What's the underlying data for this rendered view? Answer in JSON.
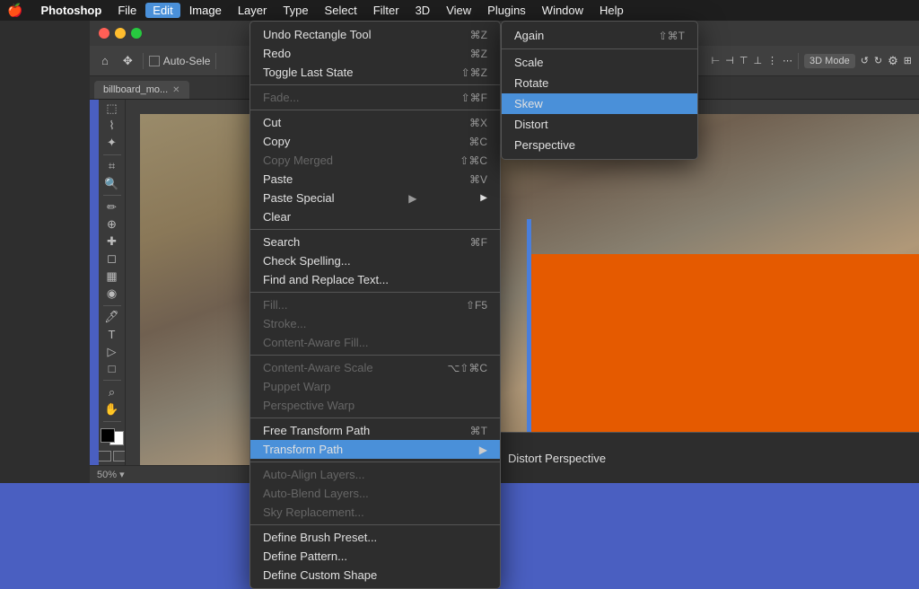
{
  "menubar": {
    "apple": "🍎",
    "items": [
      {
        "label": "Photoshop",
        "active": false,
        "weight": "bold"
      },
      {
        "label": "File",
        "active": false
      },
      {
        "label": "Edit",
        "active": true
      },
      {
        "label": "Image",
        "active": false
      },
      {
        "label": "Layer",
        "active": false
      },
      {
        "label": "Type",
        "active": false
      },
      {
        "label": "Select",
        "active": false
      },
      {
        "label": "Filter",
        "active": false
      },
      {
        "label": "3D",
        "active": false
      },
      {
        "label": "View",
        "active": false
      },
      {
        "label": "Plugins",
        "active": false
      },
      {
        "label": "Window",
        "active": false
      },
      {
        "label": "Help",
        "active": false
      }
    ]
  },
  "titlebar": {
    "traffic_lights": [
      "red",
      "yellow",
      "green"
    ]
  },
  "tabs": [
    {
      "label": "billboard_mo...",
      "active": true
    }
  ],
  "toolbar": {
    "auto_select_label": "Auto-Sele",
    "mode_label": "3D Mode",
    "checkbox": true
  },
  "edit_menu": {
    "items": [
      {
        "label": "Undo Rectangle Tool",
        "shortcut": "⌘Z",
        "disabled": false
      },
      {
        "label": "Redo",
        "shortcut": "⌘Z",
        "disabled": false
      },
      {
        "label": "Toggle Last State",
        "shortcut": "⇧⌘Z",
        "disabled": false
      },
      {
        "type": "divider"
      },
      {
        "label": "Fade...",
        "shortcut": "⇧⌘F",
        "disabled": true
      },
      {
        "type": "divider"
      },
      {
        "label": "Cut",
        "shortcut": "⌘X",
        "disabled": false
      },
      {
        "label": "Copy",
        "shortcut": "⌘C",
        "disabled": false
      },
      {
        "label": "Copy Merged",
        "shortcut": "⇧⌘C",
        "disabled": true
      },
      {
        "label": "Paste",
        "shortcut": "⌘V",
        "disabled": false
      },
      {
        "label": "Paste Special",
        "shortcut": "",
        "has_sub": true,
        "disabled": false
      },
      {
        "label": "Clear",
        "shortcut": "",
        "disabled": false
      },
      {
        "type": "divider"
      },
      {
        "label": "Search",
        "shortcut": "⌘F",
        "disabled": false
      },
      {
        "label": "Check Spelling...",
        "shortcut": "",
        "disabled": false
      },
      {
        "label": "Find and Replace Text...",
        "shortcut": "",
        "disabled": false
      },
      {
        "type": "divider"
      },
      {
        "label": "Fill...",
        "shortcut": "⇧F5",
        "disabled": true
      },
      {
        "label": "Stroke...",
        "shortcut": "",
        "disabled": true
      },
      {
        "label": "Content-Aware Fill...",
        "shortcut": "",
        "disabled": true
      },
      {
        "type": "divider"
      },
      {
        "label": "Content-Aware Scale",
        "shortcut": "⌥⇧⌘C",
        "disabled": true
      },
      {
        "label": "Puppet Warp",
        "shortcut": "",
        "disabled": true
      },
      {
        "label": "Perspective Warp",
        "shortcut": "",
        "disabled": true
      },
      {
        "type": "divider"
      },
      {
        "label": "Free Transform Path",
        "shortcut": "⌘T",
        "disabled": false
      },
      {
        "label": "Transform Path",
        "shortcut": "",
        "has_sub": true,
        "active": true,
        "disabled": false
      },
      {
        "type": "divider"
      },
      {
        "label": "Auto-Align Layers...",
        "shortcut": "",
        "disabled": true
      },
      {
        "label": "Auto-Blend Layers...",
        "shortcut": "",
        "disabled": true
      },
      {
        "label": "Sky Replacement...",
        "shortcut": "",
        "disabled": true
      },
      {
        "type": "divider"
      },
      {
        "label": "Define Brush Preset...",
        "shortcut": "",
        "disabled": false
      },
      {
        "label": "Define Pattern...",
        "shortcut": "",
        "disabled": false
      },
      {
        "label": "Define Custom Shape...",
        "shortcut": "",
        "disabled": false
      }
    ]
  },
  "transform_submenu": {
    "items": [
      {
        "label": "Again",
        "shortcut": "⇧⌘T",
        "highlighted": false
      },
      {
        "type": "divider"
      },
      {
        "label": "Scale",
        "shortcut": "",
        "highlighted": false
      },
      {
        "label": "Rotate",
        "shortcut": "",
        "highlighted": false
      },
      {
        "label": "Skew",
        "shortcut": "",
        "highlighted": true
      },
      {
        "label": "Distort",
        "shortcut": "",
        "highlighted": false
      },
      {
        "label": "Perspective",
        "shortcut": "",
        "highlighted": false
      }
    ]
  },
  "distort_label": "Distort Perspective"
}
